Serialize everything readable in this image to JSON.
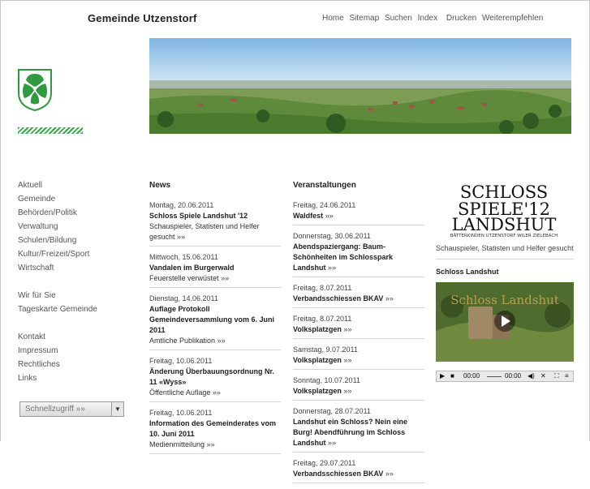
{
  "header": {
    "site_title": "Gemeinde Utzenstorf",
    "nav": [
      "Home",
      "Sitemap",
      "Suchen",
      "Index",
      "Drucken",
      "Weiterempfehlen"
    ]
  },
  "sidebar": {
    "group1": [
      "Aktuell",
      "Gemeinde",
      "Behörden/Politik",
      "Verwaltung",
      "Schulen/Bildung",
      "Kultur/Freizeit/Sport",
      "Wirtschaft"
    ],
    "group2": [
      "Wir für Sie",
      "Tageskarte Gemeinde"
    ],
    "group3": [
      "Kontakt",
      "Impressum",
      "Rechtliches",
      "Links"
    ],
    "quick_access": "Schnellzugriff »»"
  },
  "news": {
    "heading": "News",
    "items": [
      {
        "date": "Montag, 20.06.2011",
        "title": "Schloss Spiele Landshut '12",
        "text": "Schauspieler, Statisten und Helfer gesucht",
        "more": "»»"
      },
      {
        "date": "Mittwoch, 15.06.2011",
        "title": "Vandalen im Burgerwald",
        "text": "Feuerstelle verwüstet",
        "more": "»»"
      },
      {
        "date": "Dienstag, 14.06.2011",
        "title": "Auflage Protokoll Gemeindeversammlung vom 6. Juni 2011",
        "text": "Amtliche Publikation",
        "more": "»»"
      },
      {
        "date": "Freitag, 10.06.2011",
        "title": "Änderung Überbauungsordnung Nr. 11 «Wyss»",
        "text": "Öffentliche Auflage",
        "more": "»»"
      },
      {
        "date": "Freitag, 10.06.2011",
        "title": "Information des Gemeinderates vom 10. Juni 2011",
        "text": "Medienmitteilung",
        "more": "»»"
      }
    ]
  },
  "events": {
    "heading": "Veranstaltungen",
    "items": [
      {
        "date": "Freitag, 24.06.2011",
        "title": "Waldfest",
        "more": "»»"
      },
      {
        "date": "Donnerstag, 30.06.2011",
        "title": "Abendspaziergang: Baum-Schönheiten im Schlosspark Landshut",
        "more": "»»"
      },
      {
        "date": "Freitag, 8.07.2011",
        "title": "Verbandsschiessen BKAV",
        "more": "»»"
      },
      {
        "date": "Freitag, 8.07.2011",
        "title": "Volksplatzgen",
        "more": "»»"
      },
      {
        "date": "Samstag, 9.07.2011",
        "title": "Volksplatzgen",
        "more": "»»"
      },
      {
        "date": "Sonntag, 10.07.2011",
        "title": "Volksplatzgen",
        "more": "»»"
      },
      {
        "date": "Donnerstag, 28.07.2011",
        "title": "Landshut ein Schloss? Nein eine Burg! Abendführung im Schloss Landshut",
        "more": "»»"
      },
      {
        "date": "Freitag, 29.07.2011",
        "title": "Verbandsschiessen BKAV",
        "more": "»»"
      }
    ]
  },
  "promo": {
    "logo_line1": "SCHLOSS",
    "logo_line2": "SPIELE'12",
    "logo_line3": "LANDSHUT",
    "logo_sub": "BÄTTERKINDEN UTZENSTORF WILER ZIELEBACH",
    "text": "Schauspieler, Statisten und Helfer gesucht"
  },
  "video": {
    "title": "Schloss Landshut",
    "overlay": "Schloss Landshut",
    "time1": "00:00",
    "time2": "00:00"
  },
  "colors": {
    "brand_green": "#2f9a3f",
    "text": "#333333",
    "divider": "#d6d6d6"
  }
}
